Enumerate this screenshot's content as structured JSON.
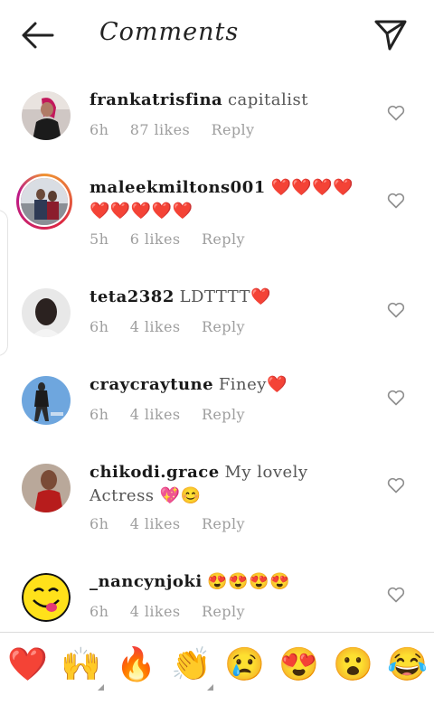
{
  "header": {
    "title": "Comments",
    "back_icon": "arrow-left-icon",
    "send_icon": "paper-plane-icon"
  },
  "comments": [
    {
      "username": "frankatrisfina",
      "text": "capitalist",
      "time": "6h",
      "likes": "87 likes",
      "reply": "Reply"
    },
    {
      "username": "maleekmiltons001",
      "text": "❤️❤️❤️❤️❤️❤️❤️❤️❤️",
      "time": "5h",
      "likes": "6 likes",
      "reply": "Reply"
    },
    {
      "username": "teta2382",
      "text": "LDTTTT❤️",
      "time": "6h",
      "likes": "4 likes",
      "reply": "Reply"
    },
    {
      "username": "craycraytune",
      "text": "Finey❤️",
      "time": "6h",
      "likes": "4 likes",
      "reply": "Reply"
    },
    {
      "username": "chikodi.grace",
      "text": "My lovely Actress 💖😊",
      "time": "6h",
      "likes": "4 likes",
      "reply": "Reply"
    },
    {
      "username": "_nancynjoki",
      "text": "😍😍😍😍",
      "time": "6h",
      "likes": "4 likes",
      "reply": "Reply"
    }
  ],
  "emoji_bar": [
    "❤️",
    "🙌",
    "🔥",
    "👏",
    "😢",
    "😍",
    "😮",
    "😂"
  ],
  "colors": {
    "heart_red": "#ed4956",
    "meta_gray": "#9e9e9e",
    "divider": "#dbdbdb"
  }
}
